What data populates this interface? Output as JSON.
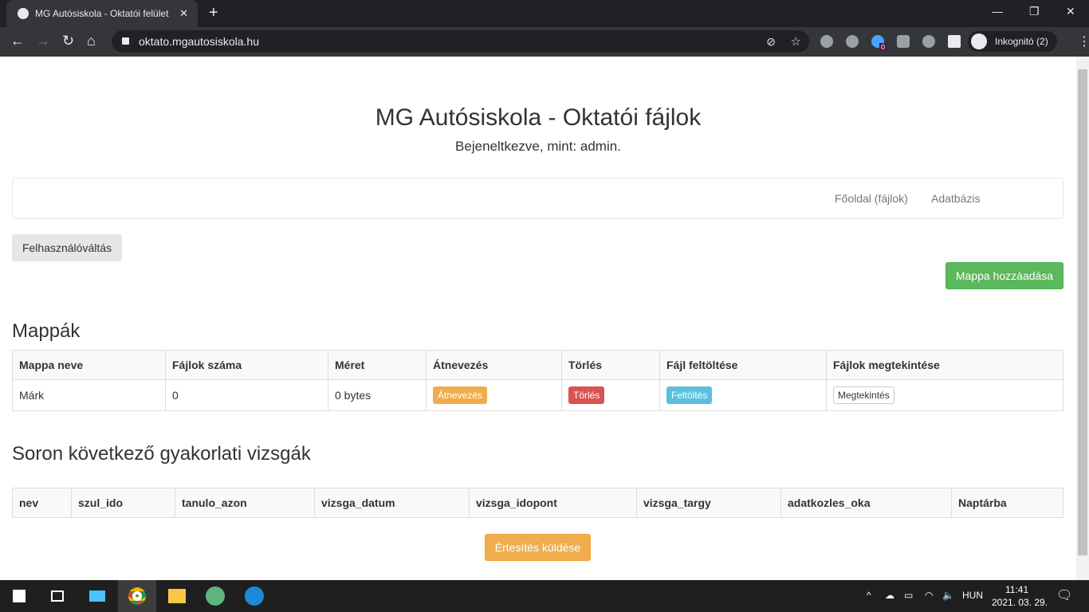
{
  "browser": {
    "tab_title": "MG Autósiskola - Oktatói felület",
    "url": "oktato.mgautosiskola.hu",
    "profile": "Inkognitó (2)",
    "ext_badge": "0"
  },
  "header": {
    "title": "MG Autósiskola - Oktatói fájlok",
    "subtitle": "Bejeneltkezve, mint: admin."
  },
  "navbar": {
    "items": [
      "Főoldal (fájlok)",
      "Adatbázis"
    ]
  },
  "buttons": {
    "switch_user": "Felhasználóváltás",
    "add_folder": "Mappa hozzáadása",
    "notify": "Értesítés küldése"
  },
  "folders": {
    "title": "Mappák",
    "columns": [
      "Mappa neve",
      "Fájlok száma",
      "Méret",
      "Átnevezés",
      "Törlés",
      "Fájl feltöltése",
      "Fájlok megtekintése"
    ],
    "rows": [
      {
        "name": "Márk",
        "count": "0",
        "size": "0 bytes",
        "rename": "Átnevezés",
        "delete": "Törlés",
        "upload": "Feltöltés",
        "view": "Megtekintés"
      }
    ]
  },
  "exams": {
    "title": "Soron következő gyakorlati vizsgák",
    "columns": [
      "nev",
      "szul_ido",
      "tanulo_azon",
      "vizsga_datum",
      "vizsga_idopont",
      "vizsga_targy",
      "adatkozles_oka",
      "Naptárba"
    ]
  },
  "taskbar": {
    "lang": "HUN",
    "time": "11:41",
    "date": "2021. 03. 29."
  },
  "colors": {
    "success": "#5cb85c",
    "warning": "#f0ad4e",
    "danger": "#d9534f",
    "info": "#5bc0de"
  }
}
